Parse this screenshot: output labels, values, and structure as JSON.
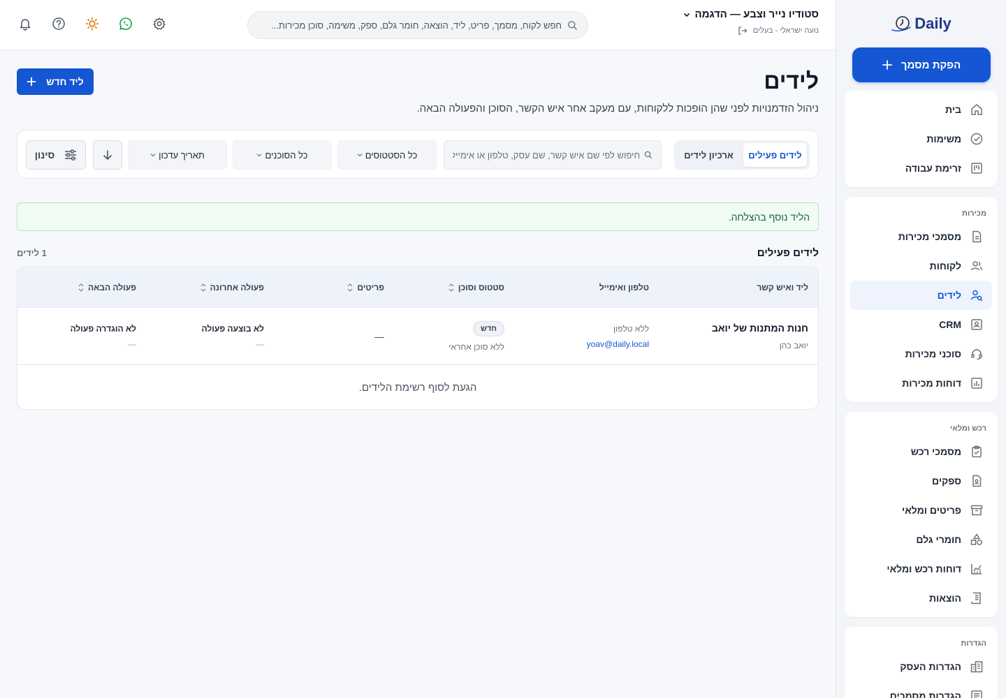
{
  "brand": {
    "logo_text": "Daily"
  },
  "sidebar": {
    "new_document_label": "הפקת מסמך",
    "main_items": [
      {
        "label": "בית",
        "icon": "home-icon"
      },
      {
        "label": "משימות",
        "icon": "check-circle-icon"
      },
      {
        "label": "זרימת עבודה",
        "icon": "kanban-icon"
      }
    ],
    "sections": [
      {
        "title": "מכירות",
        "items": [
          {
            "label": "מסמכי מכירות",
            "icon": "document-icon"
          },
          {
            "label": "לקוחות",
            "icon": "users-icon"
          },
          {
            "label": "לידים",
            "icon": "user-search-icon",
            "active": true
          },
          {
            "label": "CRM",
            "icon": "contact-card-icon"
          },
          {
            "label": "סוכני מכירות",
            "icon": "headset-icon"
          },
          {
            "label": "דוחות מכירות",
            "icon": "bar-chart-icon"
          }
        ]
      },
      {
        "title": "רכש ומלאי",
        "items": [
          {
            "label": "מסמכי רכש",
            "icon": "clipboard-check-icon"
          },
          {
            "label": "ספקים",
            "icon": "supplier-icon"
          },
          {
            "label": "פריטים ומלאי",
            "icon": "archive-icon"
          },
          {
            "label": "חומרי גלם",
            "icon": "shapes-icon"
          },
          {
            "label": "דוחות רכש ומלאי",
            "icon": "line-chart-icon"
          },
          {
            "label": "הוצאות",
            "icon": "receipt-icon"
          }
        ]
      },
      {
        "title": "הגדרות",
        "items": [
          {
            "label": "הגדרות העסק",
            "icon": "building-icon"
          },
          {
            "label": "הגדרות מסמכים",
            "icon": "doc-settings-icon"
          }
        ]
      }
    ]
  },
  "topbar": {
    "business_name": "סטודיו נייר וצבע — הדגמה",
    "user_line": "נועה ישראלי - בעלים",
    "search_placeholder": "חפש לקוח, מסמך, פריט, ליד, הוצאה, חומר גלם, ספק, משימה, סוכן מכירות..."
  },
  "page": {
    "title": "לידים",
    "subtitle": "ניהול הזדמנויות לפני שהן הופכות ללקוחות, עם מעקב אחר איש הקשר, הסוכן והפעולה הבאה.",
    "new_lead_label": "ליד חדש"
  },
  "filters": {
    "tab_active": "לידים פעילים",
    "tab_archive": "ארכיון לידים",
    "search_placeholder": "חיפוש לפי שם איש קשר, שם עסק, טלפון או אימייל",
    "status_select": "כל הסטטוסים",
    "agent_select": "כל הסוכנים",
    "sort_select": "תאריך עדכון",
    "filter_label": "סינון"
  },
  "alert": {
    "message": "הליד נוסף בהצלחה."
  },
  "list": {
    "title": "לידים פעילים",
    "count": "1 לידים",
    "columns": {
      "lead": "ליד ואיש קשר",
      "contact": "טלפון ואימייל",
      "status": "סטטוס וסוכן",
      "items": "פריטים",
      "last_action": "פעולה אחרונה",
      "next_action": "פעולה הבאה"
    },
    "rows": [
      {
        "lead_name": "חנות המתנות של יואב",
        "contact_name": "יואב כהן",
        "phone": "ללא טלפון",
        "email": "yoav@daily.local",
        "status": "חדש",
        "agent": "ללא סוכן אחראי",
        "items": "—",
        "last_action_title": "לא בוצעה פעולה",
        "last_action_sub": "—",
        "next_action_title": "לא הוגדרה פעולה",
        "next_action_sub": "—"
      }
    ],
    "end_message": "הגעת לסוף רשימת הלידים."
  },
  "colors": {
    "primary": "#1556d4",
    "success_bg": "#f0fbf3",
    "success_text": "#166534",
    "sun_icon": "#d97706",
    "whatsapp_icon": "#16a34a"
  }
}
